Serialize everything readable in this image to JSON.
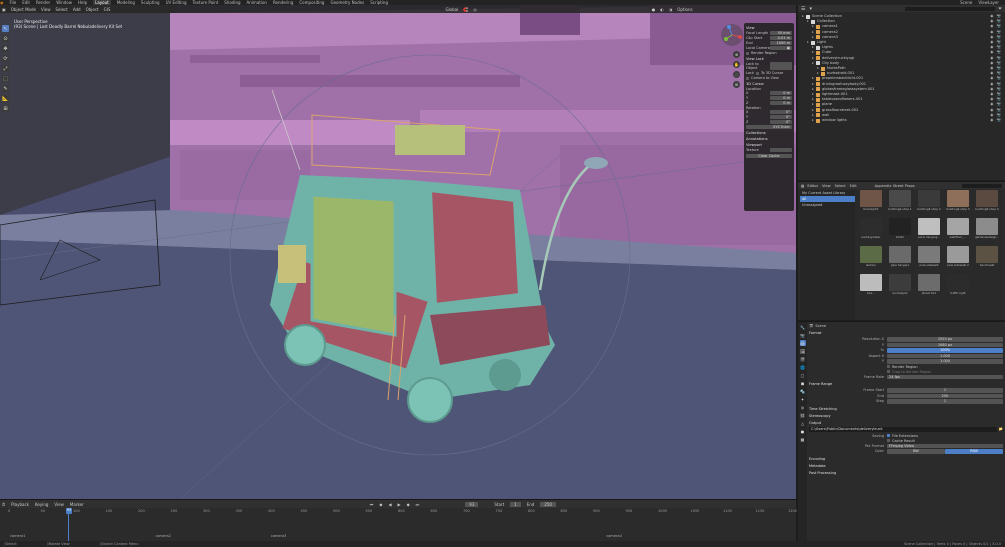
{
  "topbar": {
    "menus": [
      "File",
      "Edit",
      "Render",
      "Window",
      "Help"
    ],
    "workspaces": [
      "Layout",
      "Modeling",
      "Sculpting",
      "UV Editing",
      "Texture Paint",
      "Shading",
      "Animation",
      "Rendering",
      "Compositing",
      "Geometry Nodes",
      "Scripting"
    ],
    "scene": "Scene",
    "view_layer": "ViewLayer"
  },
  "viewport": {
    "header_items": [
      "Object Mode",
      "View",
      "Select",
      "Add",
      "Object",
      "GIS"
    ],
    "transform": "Global",
    "options": "Options",
    "info_line1": "User Perspective",
    "info_line2": "(93) Scene | Lost Deadly Barrel Nebuladelivery Kit Set",
    "tools": [
      "↖",
      "⊙",
      "✥",
      "⟳",
      "⤢",
      "⬚",
      "✎",
      "📐",
      "⊞"
    ],
    "nav_buttons": [
      "⊕",
      "✋",
      "🎥",
      "⊞"
    ]
  },
  "npanel": {
    "view_head": "View",
    "focal_length_label": "Focal Length",
    "focal_length": "50 mm",
    "clip_start_label": "Clip Start",
    "clip_start": "0.01 m",
    "clip_end_label": "End",
    "clip_end": "1000 m",
    "local_camera_label": "Local Camera",
    "render_region_label": "Render Region",
    "view_lock_head": "View Lock",
    "lock_to_object_label": "Lock to Object",
    "lock_label": "Lock",
    "to_3d_cursor": "To 3D Cursor",
    "camera_to_view": "Camera to View",
    "cursor_head": "3D Cursor",
    "location_label": "Location",
    "loc_x": "0 m",
    "loc_y": "0 m",
    "loc_z": "0 m",
    "rotation_label": "Rotation",
    "rot_x": "0°",
    "rot_y": "0°",
    "rot_z": "0°",
    "rotation_mode": "XYZ Euler",
    "collections_head": "Collections",
    "annotations_head": "Annotations",
    "lookdev_head": "Viewport",
    "texture_label": "Texture",
    "clear_button": "Clear Cache"
  },
  "timeline": {
    "menus": [
      "Playback",
      "Keying",
      "View",
      "Marker"
    ],
    "current_frame": "93",
    "start_label": "Start",
    "start": "1",
    "end_label": "End",
    "end": "250",
    "ticks": [
      "0",
      "50",
      "100",
      "150",
      "200",
      "250",
      "300",
      "350",
      "400",
      "450",
      "500",
      "550",
      "600",
      "650",
      "700",
      "750",
      "800",
      "850",
      "900",
      "950",
      "1000",
      "1050",
      "1100",
      "1150",
      "1200"
    ],
    "markers": [
      "camera1",
      "camera2",
      "camera3",
      "camera4"
    ]
  },
  "statusbar": {
    "left": "Select",
    "mid": "Rotate View",
    "mid2": "Object Context Menu",
    "right": "Scene Collection | Verts 0 | Faces 0 | Objects 0/1 | 3.0.0"
  },
  "outliner": {
    "items": [
      {
        "label": "Scene Collection",
        "depth": 0,
        "color": "#d9d9d9"
      },
      {
        "label": "Collection",
        "depth": 1,
        "color": "#d9d9d9"
      },
      {
        "label": "camera1",
        "depth": 2,
        "color": "#e0a34b"
      },
      {
        "label": "camera2",
        "depth": 2,
        "color": "#e0a34b"
      },
      {
        "label": "camera3",
        "depth": 2,
        "color": "#e0a34b"
      },
      {
        "label": "Light",
        "depth": 1,
        "color": "#d9d9d9"
      },
      {
        "label": "Lights",
        "depth": 2,
        "color": "#d9d9d9"
      },
      {
        "label": "Cube",
        "depth": 2,
        "color": "#e0a34b"
      },
      {
        "label": "deliverytruckiyugi",
        "depth": 2,
        "color": "#e0a34b"
      },
      {
        "label": "City body",
        "depth": 2,
        "color": "#d9d9d9"
      },
      {
        "label": "NurbsPath",
        "depth": 3,
        "color": "#e0a34b"
      },
      {
        "label": "nurbsdroid.001",
        "depth": 3,
        "color": "#e0a34b"
      },
      {
        "label": "propelersbacklicht.001",
        "depth": 2,
        "color": "#e0a34b"
      },
      {
        "label": "drivingroofuzzybody.001",
        "depth": 2,
        "color": "#e0a34b"
      },
      {
        "label": "globesframeglasssystem.001",
        "depth": 2,
        "color": "#e0a34b"
      },
      {
        "label": "lightmask.001",
        "depth": 2,
        "color": "#e0a34b"
      },
      {
        "label": "tablevaseoflowers.001",
        "depth": 2,
        "color": "#e0a34b"
      },
      {
        "label": "plane",
        "depth": 2,
        "color": "#e0a34b"
      },
      {
        "label": "grassfloorstreet.002",
        "depth": 2,
        "color": "#e0a34b"
      },
      {
        "label": "wall",
        "depth": 2,
        "color": "#e0a34b"
      },
      {
        "label": "window lights",
        "depth": 2,
        "color": "#e0a34b"
      }
    ]
  },
  "assets": {
    "header_items": [
      "Editor",
      "View",
      "Select",
      "Edit"
    ],
    "library": "Appendix Street Props",
    "sidebar": [
      "All",
      "Unassigned"
    ],
    "sidebar_title": "My Current Asset Library",
    "items": [
      {
        "label": "blocks/p01",
        "color": "#6f5548"
      },
      {
        "label": "building2-shop 1",
        "color": "#4a4a4a"
      },
      {
        "label": "building3-shop 2",
        "color": "#3a3a3a"
      },
      {
        "label": "building4-shop 3",
        "color": "#8d6f5a"
      },
      {
        "label": "building5-shop 4",
        "color": "#5a4a3f"
      },
      {
        "label": "parkingmeter",
        "color": "#2d2d2d"
      },
      {
        "label": "bin01",
        "color": "#222222"
      },
      {
        "label": "paris hanging...",
        "color": "#bfbfbf"
      },
      {
        "label": "wall/floor_...",
        "color": "#a5a5a5"
      },
      {
        "label": "gardenwallsign...",
        "color": "#8c8c8c"
      },
      {
        "label": "lantern",
        "color": "#5a6b46"
      },
      {
        "label": "pipe hangers",
        "color": "#6a6a6a"
      },
      {
        "label": "pole sidewalk",
        "color": "#7a7a7a"
      },
      {
        "label": "pole sidewalk 2",
        "color": "#9a9a9a"
      },
      {
        "label": "benchseat",
        "color": "#5c5244"
      },
      {
        "label": "box...",
        "color": "#bcbcbc"
      },
      {
        "label": "bucketgrid",
        "color": "#3c3c3c"
      },
      {
        "label": "street fork",
        "color": "#6c6c6c"
      },
      {
        "label": "traffic light",
        "color": "#2c2c2c"
      }
    ]
  },
  "properties": {
    "title": "Scene",
    "format_head": "Format",
    "res_x_label": "Resolution X",
    "res_x": "1920 px",
    "res_y_label": "Y",
    "res_y": "1080 px",
    "res_pct_label": "%",
    "res_pct": "100%",
    "aspect_x_label": "Aspect X",
    "aspect_x": "1.000",
    "aspect_y_label": "Y",
    "aspect_y": "1.000",
    "render_region_label": "Render Region",
    "crop_label": "Crop to Render Region",
    "frame_rate_label": "Frame Rate",
    "frame_rate": "24 fps",
    "frame_range_head": "Frame Range",
    "frame_start_label": "Frame Start",
    "frame_start": "1",
    "frame_end_label": "End",
    "frame_end": "250",
    "step_label": "Step",
    "step": "1",
    "time_stretch_head": "Time Stretching",
    "stereoscopy_head": "Stereoscopy",
    "output_head": "Output",
    "output_path": "C:\\Users\\Public\\Documents\\deliverytruck",
    "saving_label": "Saving",
    "file_ext_label": "File Extensions",
    "cache_label": "Cache Result",
    "file_format_label": "File Format",
    "file_format": "FFmpeg Video",
    "color_label": "Color",
    "color_bw": "BW",
    "color_rgb": "RGB",
    "encoding_head": "Encoding",
    "metadata_head": "Metadata",
    "postproc_head": "Post Processing"
  },
  "colors": {
    "accent": "#4d7fc9",
    "wall": "#a070a8",
    "ground": "#4e5576",
    "truck_teal": "#6fb3a8",
    "truck_red": "#a65565",
    "truck_green": "#9bb86a"
  }
}
